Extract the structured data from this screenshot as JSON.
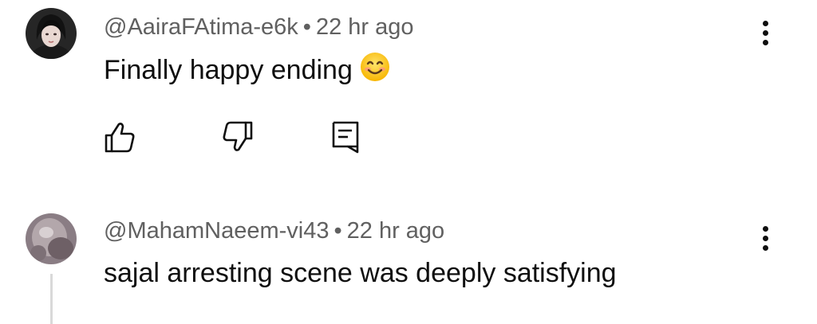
{
  "comments": [
    {
      "handle": "@AairaFAtima-e6k",
      "separator": "•",
      "time": "22 hr ago",
      "text": "Finally happy ending",
      "emoji_icon": "smiling-face-emoji",
      "avatar_color": "#2a2a2a"
    },
    {
      "handle": "@MahamNaeem-vi43",
      "separator": "•",
      "time": "22 hr ago",
      "text": "sajal arresting scene was deeply satisfying",
      "avatar_color": "#8d7f86"
    }
  ],
  "actions": {
    "like_icon": "thumbs-up-icon",
    "dislike_icon": "thumbs-down-icon",
    "reply_icon": "reply-comment-icon",
    "more_icon": "more-vertical-icon"
  },
  "colors": {
    "text_primary": "#0f0f0f",
    "text_secondary": "#606060",
    "emoji_yellow": "#ffd23f"
  }
}
